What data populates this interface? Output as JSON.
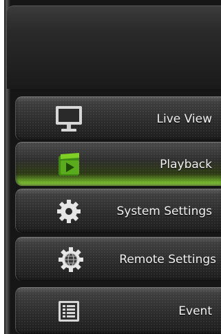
{
  "menu": {
    "items": [
      {
        "label": "Live View",
        "icon": "monitor-icon",
        "active": false
      },
      {
        "label": "Playback",
        "icon": "playback-icon",
        "active": true
      },
      {
        "label": "System Settings",
        "icon": "gear-icon",
        "active": false
      },
      {
        "label": "Remote Settings",
        "icon": "globe-gear-icon",
        "active": false
      },
      {
        "label": "Event",
        "icon": "list-icon",
        "active": false
      }
    ]
  },
  "colors": {
    "active_accent": "#8fd43e",
    "panel_background": "#161616",
    "label_text": "#f2f2f2"
  }
}
